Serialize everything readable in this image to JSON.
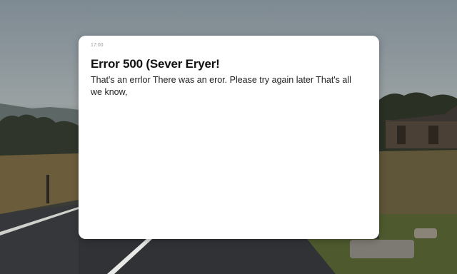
{
  "dialog": {
    "meta": "17:00",
    "title": "Error 500 (Sever Eryer!",
    "message": "That's an errlor There was an eror. Please try again later That's all we know,"
  },
  "colors": {
    "dialog_background": "#ffffff",
    "title_text": "#111111",
    "message_text": "#222222",
    "meta_text": "#9a9a9a"
  }
}
